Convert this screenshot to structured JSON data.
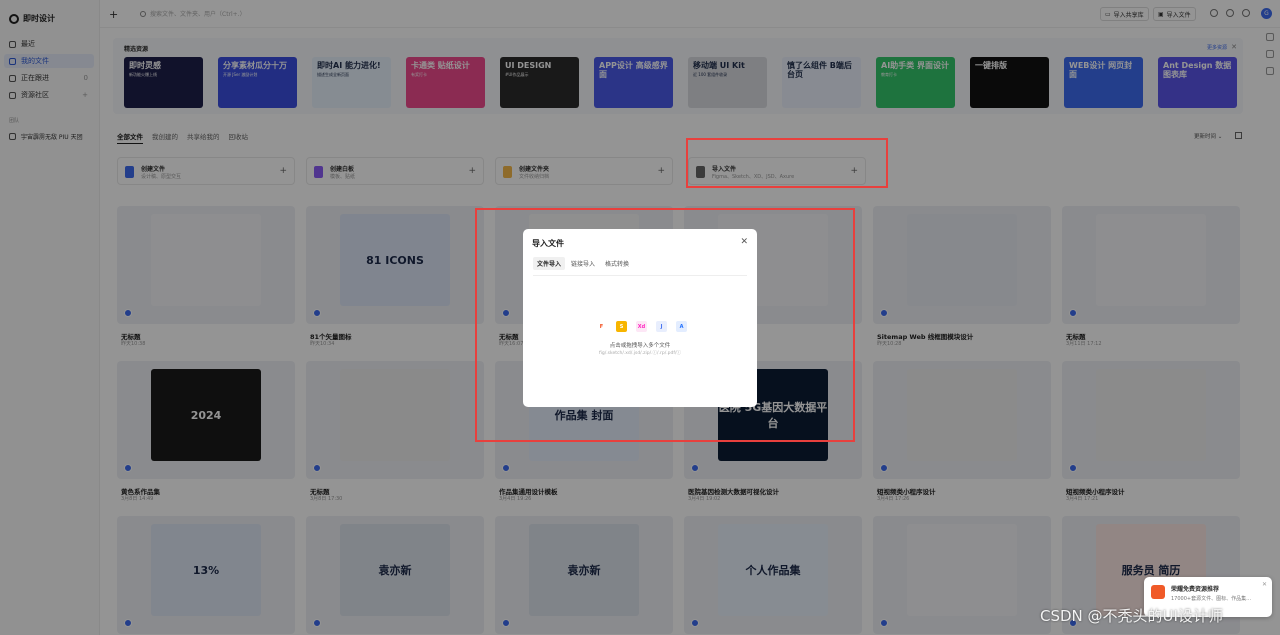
{
  "app": {
    "name": "即时设计"
  },
  "sidebar": {
    "items": [
      {
        "label": "最近",
        "tail": ""
      },
      {
        "label": "我的文件",
        "tail": ""
      },
      {
        "label": "正在跟进",
        "tail": "0"
      },
      {
        "label": "资源社区",
        "tail": "+"
      }
    ],
    "team_label": "团队",
    "team": "宇宙霹雳无敌 PIU 天团"
  },
  "topbar": {
    "search_placeholder": "搜索文件、文件夹、用户（Ctrl+.）",
    "import_library": "导入共享库",
    "import_file": "导入文件",
    "avatar": "G"
  },
  "featured": {
    "title": "精选资源",
    "more": "更多资源",
    "banners": [
      {
        "title": "即时灵感",
        "sub": "新功能火爆上线",
        "bg": "#1e1f4b"
      },
      {
        "title": "分享素材瓜分十万",
        "sub": "开源 JSer 激励计划",
        "bg": "#3b4fe0"
      },
      {
        "title": "即时AI 能力进化!",
        "sub": "描述生成全新页面",
        "bg": "#e7f1fb"
      },
      {
        "title": "卡通类 贴纸设计",
        "sub": "有奖打卡",
        "bg": "#f04a8e"
      },
      {
        "title": "UI DESIGN",
        "sub": "#UI作品展示",
        "bg": "#2b2b2b"
      },
      {
        "title": "APP设计 高级感界面",
        "sub": "",
        "bg": "#4a5ae8"
      },
      {
        "title": "移动端 UI Kit",
        "sub": "近 100 套组件收录",
        "bg": "#d9dbe0"
      },
      {
        "title": "慎了么组件 B端后台页",
        "sub": "",
        "bg": "#eaf0fb"
      },
      {
        "title": "AI助手类 界面设计",
        "sub": "教育打卡",
        "bg": "#35c76b"
      },
      {
        "title": "一键排版",
        "sub": "",
        "bg": "#121212"
      },
      {
        "title": "WEB设计 网页封面",
        "sub": "",
        "bg": "#3d6bf0"
      },
      {
        "title": "Ant Design 数据图表库",
        "sub": "",
        "bg": "#5b55e8"
      }
    ]
  },
  "tabs": [
    "全部文件",
    "我创建的",
    "共享给我的",
    "回收站"
  ],
  "sort": "更新时间 ⌄",
  "create": [
    {
      "title": "创建文件",
      "sub": "设计稿、原型交互",
      "color": "#3d6bf0"
    },
    {
      "title": "创建白板",
      "sub": "模板、贴纸",
      "color": "#8b5cf6"
    },
    {
      "title": "创建文件夹",
      "sub": "文件收纳归档",
      "color": "#f5b94a"
    },
    {
      "title": "导入文件",
      "sub": "Figma、Sketch、XD、JSD、Axure",
      "color": "#666666"
    }
  ],
  "cards": [
    {
      "name": "无标题",
      "date": "昨天10:38",
      "color": "#f4f5f8"
    },
    {
      "name": "81个矢量图标",
      "date": "昨天10:34",
      "color": "#dde6f7",
      "inner": "81 ICONS"
    },
    {
      "name": "无标题",
      "date": "昨天16:07",
      "color": "#f7f7f7"
    },
    {
      "name": "",
      "date": "",
      "color": "#f4f5f8"
    },
    {
      "name": "Sitemap Web 线框图模块设计",
      "date": "昨天10:28",
      "color": "#e9ecf3"
    },
    {
      "name": "无标题",
      "date": "3月11日 17:12",
      "color": "#f4f5f8"
    },
    {
      "name": "黄色系作品集",
      "date": "3月8日 14:49",
      "color": "#1b1b1b",
      "inner": "2024"
    },
    {
      "name": "无标题",
      "date": "3月8日 17:30",
      "color": "#eeeeee"
    },
    {
      "name": "作品集通用设计模板",
      "date": "3月4日 19:26",
      "color": "#e6eefc",
      "inner": "作品集 封面"
    },
    {
      "name": "医院基因检测大数据可视化设计",
      "date": "3月4日 19:02",
      "color": "#0b1d35",
      "inner": "医院 5G基因大数据平台"
    },
    {
      "name": "短视频类小程序设计",
      "date": "3月4日 17:26",
      "color": "#f0f0f0"
    },
    {
      "name": "短视频类小程序设计",
      "date": "3月4日 17:21",
      "color": "#f0f0f0"
    },
    {
      "name": "",
      "date": "",
      "color": "#dfe7f5",
      "inner": "13%"
    },
    {
      "name": "",
      "date": "",
      "color": "#dde3ec",
      "inner": "袁亦新"
    },
    {
      "name": "",
      "date": "",
      "color": "#dde3ec",
      "inner": "袁亦新"
    },
    {
      "name": "",
      "date": "",
      "color": "#e9f1fb",
      "inner": "个人作品集"
    },
    {
      "name": "",
      "date": "",
      "color": "#f4f5f8"
    },
    {
      "name": "",
      "date": "",
      "color": "#fbe7e3",
      "inner": "服务员 简历"
    }
  ],
  "modal": {
    "title": "导入文件",
    "tabs": [
      "文件导入",
      "链接导入",
      "格式转换"
    ],
    "drop_text": "点击或拖拽导入多个文件",
    "drop_sub": "fig/.sketch/.xd/.jsd/.zip/.ⓘ/.rp/.pdf/ⓘ",
    "file_types": [
      "F",
      "S",
      "Xd",
      "J",
      "A"
    ]
  },
  "notif": {
    "title": "荣耀免费资源推荐",
    "sub": "17000+套源文件、图标、作品集…"
  },
  "watermark": "CSDN @不秃头的UI设计师"
}
